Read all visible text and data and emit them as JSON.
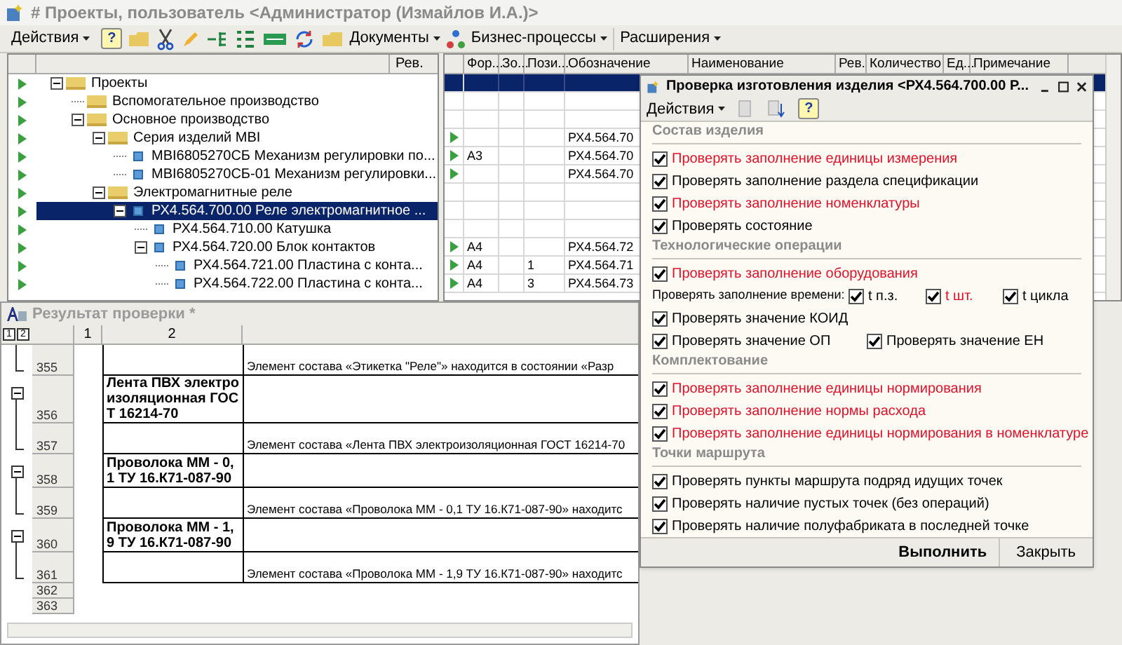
{
  "window": {
    "title": "# Проекты, пользователь <Администратор (Измайлов И.А.)>"
  },
  "toolbar": {
    "actions_menu": "Действия",
    "help": "?",
    "menus": [
      "Документы",
      "Бизнес-процессы",
      "Расширения"
    ]
  },
  "tree": {
    "column": "Рев.",
    "nodes": [
      {
        "label": "Проекты",
        "kind": "folder",
        "expanded": true,
        "selected": false,
        "children": [
          {
            "label": "Вспомогательное производство",
            "kind": "folder",
            "selected": false
          },
          {
            "label": "Основное производство",
            "kind": "folder",
            "expanded": true,
            "selected": false,
            "children": [
              {
                "label": "Серия изделий MBI",
                "kind": "folder",
                "expanded": true,
                "selected": false,
                "children": [
                  {
                    "label": "MBI6805270СБ Механизм регулировки по...",
                    "kind": "item",
                    "selected": false
                  },
                  {
                    "label": "MBI6805270СБ-01 Механизм регулировки...",
                    "kind": "item",
                    "selected": false
                  }
                ]
              },
              {
                "label": "Электромагнитные реле",
                "kind": "folder",
                "expanded": true,
                "selected": false,
                "children": [
                  {
                    "label": "РХ4.564.700.00 Реле электромагнитное ...",
                    "kind": "item",
                    "expanded": true,
                    "selected": true,
                    "children": [
                      {
                        "label": "РХ4.564.710.00 Катушка",
                        "kind": "item",
                        "selected": false
                      },
                      {
                        "label": "РХ4.564.720.00 Блок контактов",
                        "kind": "item",
                        "expanded": true,
                        "selected": false,
                        "children": [
                          {
                            "label": "РХ4.564.721.00 Пластина с конта...",
                            "kind": "item",
                            "selected": false
                          },
                          {
                            "label": "РХ4.564.722.00 Пластина с конта...",
                            "kind": "item",
                            "selected": false
                          }
                        ]
                      }
                    ]
                  }
                ]
              }
            ]
          }
        ]
      }
    ]
  },
  "grid": {
    "columns": [
      "Фор...",
      "Зо...",
      "Пози...",
      "Обозначение",
      "Наименование",
      "Рев.",
      "Количество",
      "Ед...",
      "Примечание"
    ],
    "rows": [
      {
        "selected": true,
        "marker": false,
        "cells": [
          "",
          "",
          "",
          ""
        ]
      },
      {
        "selected": false,
        "marker": false,
        "cells": [
          "",
          "",
          "",
          ""
        ]
      },
      {
        "selected": false,
        "marker": false,
        "cells": [
          "",
          "",
          "",
          ""
        ]
      },
      {
        "selected": false,
        "marker": true,
        "cells": [
          "",
          "",
          "",
          "РХ4.564.70"
        ]
      },
      {
        "selected": false,
        "marker": true,
        "cells": [
          "А3",
          "",
          "",
          "РХ4.564.70"
        ]
      },
      {
        "selected": false,
        "marker": true,
        "cells": [
          "",
          "",
          "",
          "РХ4.564.70"
        ]
      },
      {
        "selected": false,
        "marker": false,
        "cells": [
          "",
          "",
          "",
          ""
        ]
      },
      {
        "selected": false,
        "marker": false,
        "cells": [
          "",
          "",
          "",
          ""
        ]
      },
      {
        "selected": false,
        "marker": false,
        "cells": [
          "",
          "",
          "",
          ""
        ]
      },
      {
        "selected": false,
        "marker": true,
        "cells": [
          "А4",
          "",
          "",
          "РХ4.564.72"
        ]
      },
      {
        "selected": false,
        "marker": true,
        "cells": [
          "А4",
          "",
          "1",
          "РХ4.564.71"
        ]
      },
      {
        "selected": false,
        "marker": true,
        "cells": [
          "А4",
          "",
          "3",
          "РХ4.564.73"
        ]
      }
    ]
  },
  "result": {
    "title": "Результат проверки *",
    "outline_levels": [
      "1",
      "2"
    ],
    "columns": [
      "1",
      "2"
    ],
    "rows": [
      {
        "number": "355",
        "kind": "group_end",
        "column_2": "",
        "column_3": "Элемент состава «Этикетка \"Реле\"» находится в состоянии «Разр"
      },
      {
        "number": "356",
        "kind": "group_start",
        "column_2": "Лента ПВХ электроизоляционная ГОСТ 16214-70",
        "column_3": ""
      },
      {
        "number": "357",
        "kind": "group_end",
        "column_2": "",
        "column_3": "Элемент состава «Лента ПВХ электроизоляционная ГОСТ 16214-70"
      },
      {
        "number": "358",
        "kind": "group_start",
        "column_2": "Проволока ММ - 0,1 ТУ 16.К71-087-90",
        "column_3": ""
      },
      {
        "number": "359",
        "kind": "group_end",
        "column_2": "",
        "column_3": "Элемент состава «Проволока ММ - 0,1 ТУ 16.К71-087-90» находитс"
      },
      {
        "number": "360",
        "kind": "group_start",
        "column_2": "Проволока ММ - 1,9 ТУ 16.К71-087-90",
        "column_3": ""
      },
      {
        "number": "361",
        "kind": "group_end",
        "column_2": "",
        "column_3": "Элемент состава «Проволока ММ - 1,9 ТУ 16.К71-087-90» находитс"
      },
      {
        "number": "362",
        "kind": "plain",
        "column_2": "",
        "column_3": ""
      },
      {
        "number": "363",
        "kind": "plain",
        "column_2": "",
        "column_3": ""
      }
    ]
  },
  "dialog": {
    "title": "Проверка изготовления изделия <РХ4.564.700.00 Р...",
    "actions_menu": "Действия",
    "help": "?",
    "sections": [
      {
        "title": "Состав изделия",
        "items": [
          {
            "kind": "check",
            "label": "Проверять заполнение единицы измерения",
            "checked": true,
            "highlighted": true
          },
          {
            "kind": "check",
            "label": "Проверять заполнение раздела спецификации",
            "checked": true,
            "highlighted": false
          },
          {
            "kind": "check",
            "label": "Проверять заполнение номенклатуры",
            "checked": true,
            "highlighted": true
          },
          {
            "kind": "check",
            "label": "Проверять состояние",
            "checked": true,
            "highlighted": false
          }
        ]
      },
      {
        "title": "Технологические операции",
        "items": [
          {
            "kind": "check",
            "label": "Проверять заполнение оборудования",
            "checked": true,
            "highlighted": true
          },
          {
            "kind": "time",
            "label": "Проверять заполнение времени:",
            "options": [
              {
                "label": "t п.з.",
                "checked": true,
                "highlighted": false
              },
              {
                "label": "t шт.",
                "checked": true,
                "highlighted": true
              },
              {
                "label": "t цикла",
                "checked": true,
                "highlighted": false
              }
            ]
          },
          {
            "kind": "check",
            "label": "Проверять значение КОИД",
            "checked": true,
            "highlighted": false
          },
          {
            "kind": "pair",
            "options": [
              {
                "label": "Проверять значение ОП",
                "checked": true,
                "highlighted": false
              },
              {
                "label": "Проверять значение ЕН",
                "checked": true,
                "highlighted": false
              }
            ]
          }
        ]
      },
      {
        "title": "Комплектование",
        "items": [
          {
            "kind": "check",
            "label": "Проверять заполнение единицы нормирования",
            "checked": true,
            "highlighted": true
          },
          {
            "kind": "check",
            "label": "Проверять заполнение нормы расхода",
            "checked": true,
            "highlighted": true
          },
          {
            "kind": "check",
            "label": "Проверять заполнение единицы нормирования в номенклатуре",
            "checked": true,
            "highlighted": true
          }
        ]
      },
      {
        "title": "Точки маршрута",
        "items": [
          {
            "kind": "check",
            "label": "Проверять пункты маршрута подряд идущих точек",
            "checked": true,
            "highlighted": false
          },
          {
            "kind": "check",
            "label": "Проверять наличие пустых точек (без операций)",
            "checked": true,
            "highlighted": false
          },
          {
            "kind": "check",
            "label": "Проверять наличие полуфабриката в последней точке",
            "checked": true,
            "highlighted": false
          }
        ]
      }
    ],
    "buttons": [
      {
        "label": "Выполнить",
        "default": true
      },
      {
        "label": "Закрыть",
        "default": false
      }
    ]
  }
}
